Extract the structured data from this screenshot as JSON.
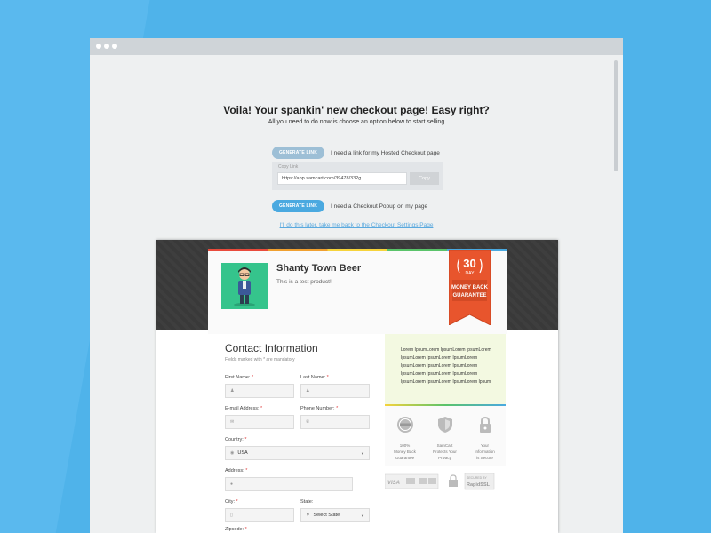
{
  "headline": "Voila! Your spankin' new checkout page! Easy right?",
  "subline": "All you need to do now is choose an option below to start selling",
  "options": [
    {
      "button": "GENERATE LINK",
      "label": "I need a link for my Hosted Checkout page"
    },
    {
      "button": "GENERATE LINK",
      "label": "I need a Checkout Popup on my page"
    }
  ],
  "copy_link": {
    "label": "Copy Link",
    "value": "https://app.samcart.com/39478/332g",
    "button": "Copy"
  },
  "later_link": "I'll do this later, take me back to the Checkout Settings Page",
  "product": {
    "name": "Shanty Town Beer",
    "description": "This is a test product!"
  },
  "badge": {
    "number": "30",
    "unit": "DAY",
    "line1": "MONEY BACK",
    "line2": "GUARANTEE"
  },
  "form": {
    "title": "Contact Information",
    "note": "Fields marked with * are mandatory",
    "required_mark": "*",
    "first_name": "First Name:",
    "last_name": "Last Name:",
    "email": "E-mail Address:",
    "phone": "Phone Number:",
    "country": "Country:",
    "country_value": "USA",
    "address": "Address:",
    "city": "City:",
    "state": "State:",
    "state_value": "Select State",
    "zipcode": "Zipcode:"
  },
  "lorem": "Lorem IpsumLorem IpsumLorem IpsumLorem IpsumLorem IpsumLorem IpsumLorem IpsumLorem IpsumLorem IpsumLorem IpsumLorem IpsumLorem IpsumLorem IpsumLorem IpsumLorem IpsumLorem Ipsum",
  "guarantees": [
    {
      "icon": "money-back-seal-icon",
      "text1": "100%",
      "text2": "Money Back",
      "text3": "Guarantee"
    },
    {
      "icon": "shield-icon",
      "text1": "SamCart",
      "text2": "Protects Your",
      "text3": "Privacy"
    },
    {
      "icon": "lock-icon",
      "text1": "Your",
      "text2": "Information",
      "text3": "is Secure"
    }
  ],
  "trust": {
    "cards": "VISA",
    "secure": "SECURED BY",
    "ssl": "RapidSSL"
  },
  "colors": {
    "background": "#4fb3ea",
    "accent": "#4aa9e0",
    "ribbon": "#e8552d"
  }
}
